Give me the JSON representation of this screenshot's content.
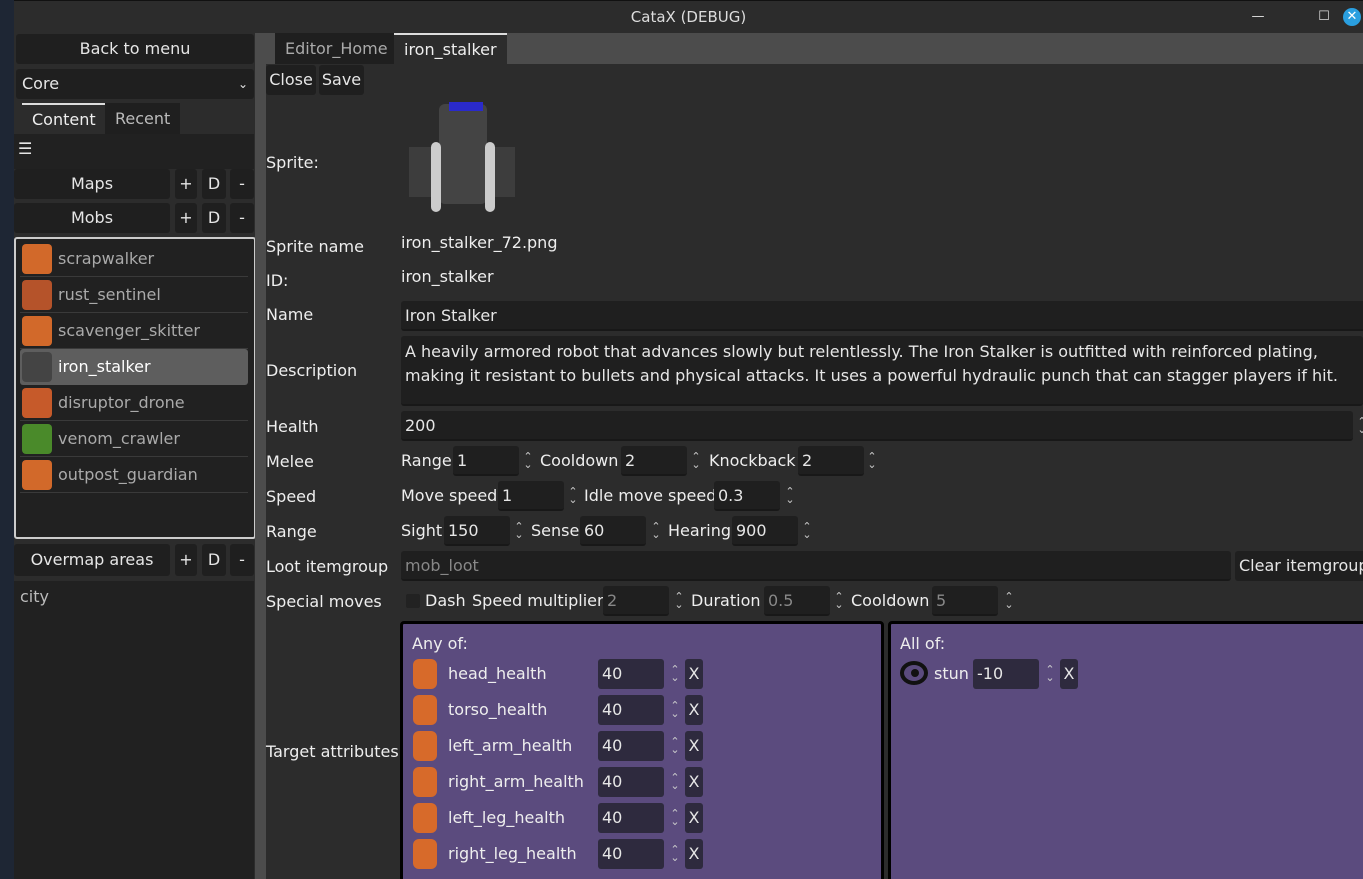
{
  "window": {
    "title": "CataX (DEBUG)",
    "minimize": "—",
    "maximize": "☐",
    "close": "✕"
  },
  "sidebar": {
    "back": "Back to menu",
    "mod_select": "Core",
    "tabs": [
      "Content",
      "Recent"
    ],
    "menu_icon": "☰",
    "sections": [
      {
        "label": "Maps",
        "add": "+",
        "dup": "D",
        "del": "-"
      },
      {
        "label": "Mobs",
        "add": "+",
        "dup": "D",
        "del": "-"
      },
      {
        "label": "Overmap areas",
        "add": "+",
        "dup": "D",
        "del": "-"
      }
    ],
    "mobs": [
      {
        "name": "scrapwalker",
        "color": "#d2692a"
      },
      {
        "name": "rust_sentinel",
        "color": "#b5532a"
      },
      {
        "name": "scavenger_skitter",
        "color": "#d2692a"
      },
      {
        "name": "iron_stalker",
        "color": "#444444"
      },
      {
        "name": "disruptor_drone",
        "color": "#c65a2a"
      },
      {
        "name": "venom_crawler",
        "color": "#4a8a2a"
      },
      {
        "name": "outpost_guardian",
        "color": "#d2692a"
      }
    ],
    "selected_mob": "iron_stalker",
    "overmap_areas": [
      "city"
    ]
  },
  "tabs": [
    "Editor_Home",
    "iron_stalker"
  ],
  "toolbar": {
    "close": "Close",
    "save": "Save"
  },
  "form": {
    "sprite_label": "Sprite:",
    "sprite_name_label": "Sprite name",
    "sprite_name": "iron_stalker_72.png",
    "id_label": "ID:",
    "id": "iron_stalker",
    "name_label": "Name",
    "name": "Iron Stalker",
    "description_label": "Description",
    "description": "A heavily armored robot that advances slowly but relentlessly. The Iron Stalker is outfitted with reinforced plating, making it resistant to bullets and physical attacks. It uses a powerful hydraulic punch that can stagger players if hit.",
    "health_label": "Health",
    "health": "200",
    "melee_label": "Melee",
    "melee": {
      "range_label": "Range",
      "range": "1",
      "cooldown_label": "Cooldown",
      "cooldown": "2",
      "knockback_label": "Knockback",
      "knockback": "2"
    },
    "speed_label": "Speed",
    "speed": {
      "move_label": "Move speed",
      "move": "1",
      "idle_label": "Idle move speed",
      "idle": "0.3"
    },
    "range_label": "Range",
    "range": {
      "sight_label": "Sight",
      "sight": "150",
      "sense_label": "Sense",
      "sense": "60",
      "hearing_label": "Hearing",
      "hearing": "900"
    },
    "loot_label": "Loot itemgroup",
    "loot_placeholder": "mob_loot",
    "clear_itemgroup": "Clear itemgroup",
    "special_label": "Special moves",
    "special": {
      "dash_label": "Dash",
      "dash_checked": false,
      "mult_label": "Speed multiplier",
      "mult": "2",
      "duration_label": "Duration",
      "duration": "0.5",
      "cooldown_label": "Cooldown",
      "cooldown": "5"
    },
    "target_label": "Target attributes",
    "any_of": {
      "title": "Any of:",
      "items": [
        {
          "name": "head_health",
          "value": "40"
        },
        {
          "name": "torso_health",
          "value": "40"
        },
        {
          "name": "left_arm_health",
          "value": "40"
        },
        {
          "name": "right_arm_health",
          "value": "40"
        },
        {
          "name": "left_leg_health",
          "value": "40"
        },
        {
          "name": "right_leg_health",
          "value": "40"
        }
      ]
    },
    "all_of": {
      "title": "All of:",
      "items": [
        {
          "name": "stun",
          "value": "-10"
        }
      ]
    },
    "remove_label": "X"
  },
  "colors": {
    "accent_purple": "#5b4b7e",
    "close_blue": "#2a9fe0"
  }
}
